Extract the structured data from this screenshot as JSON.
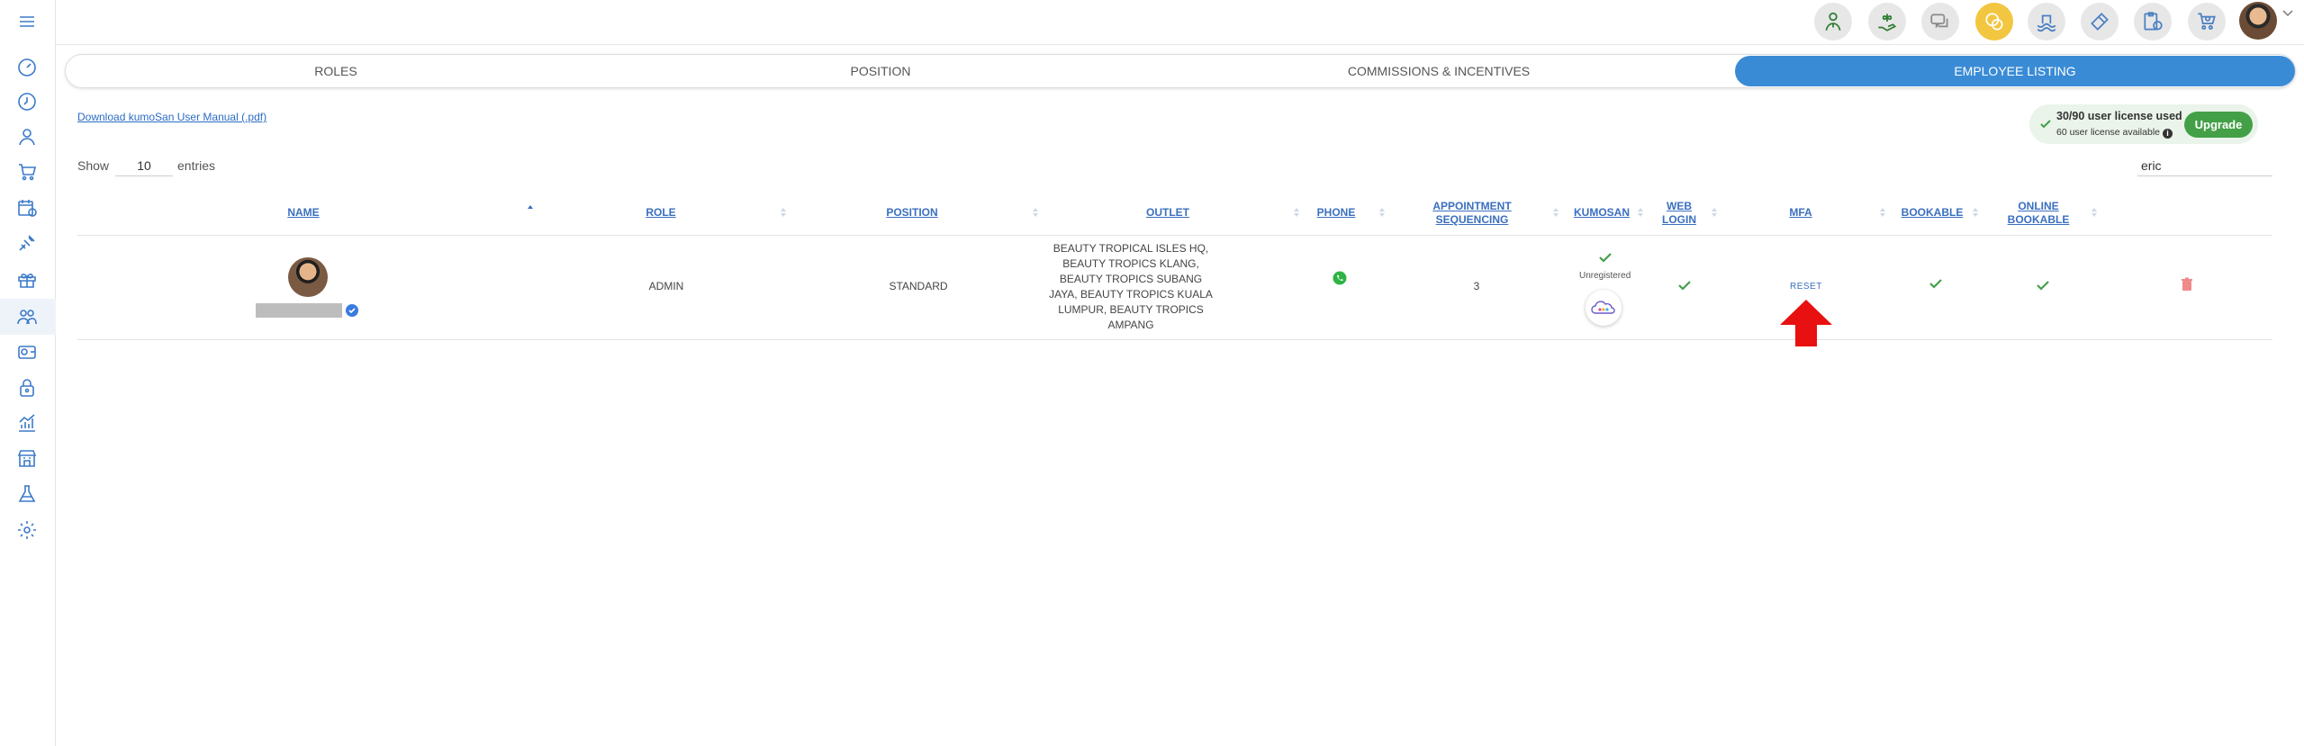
{
  "sidebar": {
    "menu_icon": "hamburger-menu-icon",
    "items": [
      {
        "icon": "dashboard-icon"
      },
      {
        "icon": "clock-icon"
      },
      {
        "icon": "user-icon"
      },
      {
        "icon": "cart-icon"
      },
      {
        "icon": "calendar-clock-icon"
      },
      {
        "icon": "service-icon"
      },
      {
        "icon": "gift-box-icon"
      },
      {
        "icon": "employees-icon"
      },
      {
        "icon": "wallet-icon"
      },
      {
        "icon": "lock-icon"
      },
      {
        "icon": "chart-icon"
      },
      {
        "icon": "store-icon"
      },
      {
        "icon": "lab-flask-icon"
      },
      {
        "icon": "settings-icon"
      }
    ]
  },
  "topbar": {
    "buttons": [
      "staff-icon",
      "hand-plant-icon",
      "chat-icon",
      "coins-icon",
      "pool-icon",
      "tools-icon",
      "clipboard-clock-icon",
      "cart-gear-icon"
    ]
  },
  "tabs": [
    {
      "label": "ROLES",
      "active": false
    },
    {
      "label": "POSITION",
      "active": false
    },
    {
      "label": "COMMISSIONS & INCENTIVES",
      "active": false
    },
    {
      "label": "EMPLOYEE LISTING",
      "active": true
    }
  ],
  "manual_link": "Download kumoSan User Manual (.pdf)",
  "license": {
    "title": "30/90 user license used",
    "subtitle": "60 user license available",
    "upgrade_label": "Upgrade"
  },
  "show": {
    "label_before": "Show",
    "value": "10",
    "label_after": "entries"
  },
  "search": {
    "value": "eric"
  },
  "table": {
    "columns": [
      {
        "key": "name",
        "lines": [
          "NAME"
        ]
      },
      {
        "key": "role",
        "lines": [
          "ROLE"
        ]
      },
      {
        "key": "position",
        "lines": [
          "POSITION"
        ]
      },
      {
        "key": "outlet",
        "lines": [
          "OUTLET"
        ]
      },
      {
        "key": "phone",
        "lines": [
          "PHONE"
        ]
      },
      {
        "key": "appointment",
        "lines": [
          "APPOINTMENT",
          "SEQUENCING"
        ]
      },
      {
        "key": "kumosan",
        "lines": [
          "KUMOSAN"
        ]
      },
      {
        "key": "web_login",
        "lines": [
          "WEB",
          "LOGIN"
        ]
      },
      {
        "key": "mfa",
        "lines": [
          "MFA"
        ]
      },
      {
        "key": "bookable",
        "lines": [
          "BOOKABLE"
        ]
      },
      {
        "key": "online_bookable",
        "lines": [
          "ONLINE",
          "BOOKABLE"
        ]
      }
    ],
    "rows": [
      {
        "role": "ADMIN",
        "position": "STANDARD",
        "outlet_lines": [
          "BEAUTY TROPICAL ISLES HQ,",
          "BEAUTY TROPICS KLANG,",
          "BEAUTY TROPICS SUBANG",
          "JAYA, BEAUTY TROPICS KUALA",
          "LUMPUR, BEAUTY TROPICS",
          "AMPANG"
        ],
        "appointment_sequencing": "3",
        "kumosan_status": "Unregistered",
        "mfa_action": "RESET"
      }
    ]
  },
  "colors": {
    "accent": "#3a8bd6",
    "link": "#3a6fbf",
    "check": "#43a047",
    "delete": "#e57373",
    "arrow": "#e81010"
  }
}
